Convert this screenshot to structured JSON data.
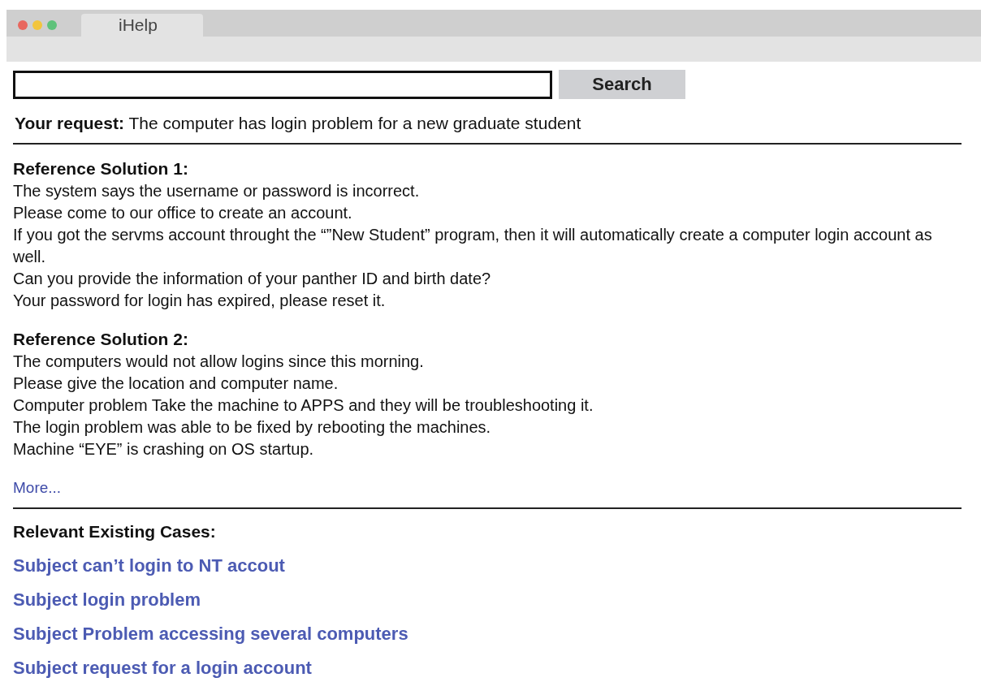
{
  "window": {
    "tab_title": "iHelp"
  },
  "search": {
    "button": "Search"
  },
  "request": "**Your request:** The computer has login problem for a new graduate student",
  "solutions": [
    {
      "title": "Reference Solution 1:",
      "lines": [
        "The system says the username or password is incorrect.",
        "Please come to our office to create an account.",
        "If you got the servms account throught the “”New Student” program, then it will automatically create a computer login account as well.",
        "Can you provide the information of your panther ID and birth date?",
        "Your password for login has expired, please reset it."
      ]
    },
    {
      "title": "Reference Solution 2:",
      "lines": [
        "The computers would not allow logins since this morning.",
        "Please give the location and computer name.",
        "Computer problem Take the machine to APPS and they will be troubleshooting it.",
        "The login problem was able to be fixed by rebooting the machines.",
        "Machine “EYE” is crashing on OS startup."
      ]
    }
  ],
  "more_link": "More...",
  "cases": {
    "title": "Relevant Existing Cases:",
    "links": [
      "Subject can’t login to NT accout",
      "Subject login problem",
      "Subject Problem accessing several computers",
      "Subject request for a login account"
    ]
  }
}
